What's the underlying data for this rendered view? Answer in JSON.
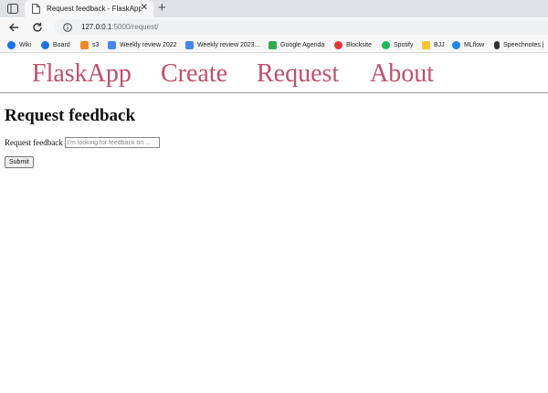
{
  "browser": {
    "tab": {
      "title": "Request feedback - FlaskApp",
      "close": "✕"
    },
    "new_tab": "+",
    "url": {
      "host": "127.0.0.1",
      "rest": ":5000/request/"
    },
    "bookmarks": [
      {
        "label": "Wiki",
        "icon": "cloud-icon",
        "color": "#1a73e8"
      },
      {
        "label": "Board",
        "icon": "cloud-icon",
        "color": "#1a73e8"
      },
      {
        "label": "s3",
        "icon": "cube-icon",
        "color": "#f08a24"
      },
      {
        "label": "Weekly review 2022",
        "icon": "doc-icon",
        "color": "#4285f4"
      },
      {
        "label": "Weekly review 2023...",
        "icon": "doc-icon",
        "color": "#4285f4"
      },
      {
        "label": "Google Agenda",
        "icon": "calendar-icon",
        "color": "#34a853"
      },
      {
        "label": "Blocksite",
        "icon": "shield-icon",
        "color": "#e53935"
      },
      {
        "label": "Spotify",
        "icon": "spotify-icon",
        "color": "#1db954"
      },
      {
        "label": "BJJ",
        "icon": "folder-icon",
        "color": "#f4c430"
      },
      {
        "label": "MLflow",
        "icon": "mlflow-icon",
        "color": "#1e88e5"
      },
      {
        "label": "Speechnotes |",
        "icon": "mic-icon",
        "color": "#333333"
      }
    ]
  },
  "nav": {
    "brand": "FlaskApp",
    "create": "Create",
    "request": "Request",
    "about": "About"
  },
  "main": {
    "heading": "Request feedback",
    "field_label": "Request feedback",
    "field_placeholder": "I'm looking for feedback on ...",
    "submit": "Submit"
  },
  "colors": {
    "link": "#c0506a"
  }
}
